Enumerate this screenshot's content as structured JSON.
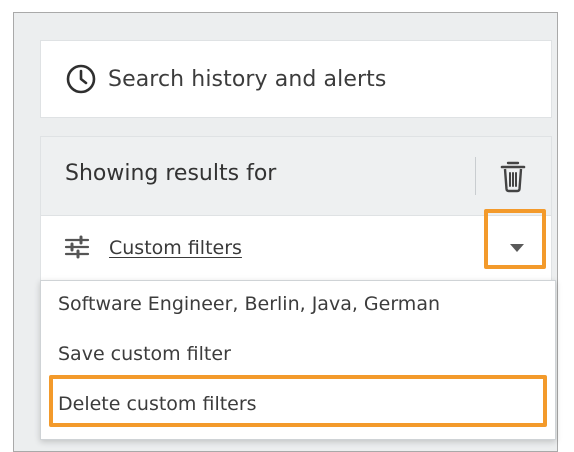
{
  "search_history": {
    "label": "Search history and alerts",
    "icon": "clock-icon"
  },
  "results": {
    "title": "Showing results for",
    "delete_icon": "trash-icon",
    "filter": {
      "icon": "sliders-icon",
      "label": "Custom filters",
      "toggle_icon": "caret-down-icon"
    }
  },
  "dropdown": {
    "items": [
      {
        "label": "Software Engineer, Berlin, Java, German"
      },
      {
        "label": "Save custom filter"
      },
      {
        "label": "Delete custom filters"
      }
    ]
  },
  "colors": {
    "highlight": "#f39a2b",
    "panel_bg": "#eceeef",
    "text": "#3a3a3a"
  }
}
